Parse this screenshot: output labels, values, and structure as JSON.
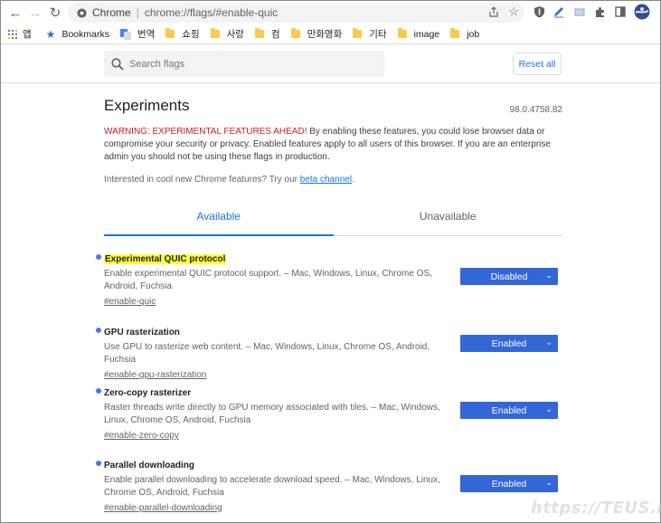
{
  "omnibox": {
    "site": "Chrome",
    "url": "chrome://flags/#enable-quic"
  },
  "bookmarks": [
    {
      "label": "앱",
      "icon": "apps-grid-icon"
    },
    {
      "label": "Bookmarks",
      "icon": "star-icon"
    },
    {
      "label": "번역",
      "icon": "translate-icon"
    },
    {
      "label": "쇼핑",
      "icon": "folder-icon"
    },
    {
      "label": "사랑",
      "icon": "folder-icon"
    },
    {
      "label": "컴",
      "icon": "folder-icon"
    },
    {
      "label": "만화영화",
      "icon": "folder-icon"
    },
    {
      "label": "기타",
      "icon": "folder-icon"
    },
    {
      "label": "image",
      "icon": "folder-icon"
    },
    {
      "label": "job",
      "icon": "folder-icon"
    }
  ],
  "search": {
    "placeholder": "Search flags"
  },
  "reset_label": "Reset all",
  "page": {
    "title": "Experiments",
    "version": "98.0.4758.82",
    "warning_red": "WARNING: EXPERIMENTAL FEATURES AHEAD!",
    "warning_text": " By enabling these features, you could lose browser data or compromise your security or privacy. Enabled features apply to all users of this browser. If you are an enterprise admin you should not be using these flags in production.",
    "interest_text": "Interested in cool new Chrome features? Try our ",
    "interest_link": "beta channel",
    "interest_end": "."
  },
  "tabs": [
    {
      "label": "Available",
      "active": true
    },
    {
      "label": "Unavailable",
      "active": false
    }
  ],
  "flags": [
    {
      "name": "Experimental QUIC protocol",
      "description": "Enable experimental QUIC protocol support. – Mac, Windows, Linux, Chrome OS, Android, Fuchsia",
      "id": "#enable-quic",
      "value": "Disabled",
      "highlighted": true
    },
    {
      "name": "GPU rasterization",
      "description": "Use GPU to rasterize web content. – Mac, Windows, Linux, Chrome OS, Android, Fuchsia",
      "id": "#enable-gpu-rasterization",
      "value": "Enabled",
      "highlighted": false
    },
    {
      "name": "Zero-copy rasterizer",
      "description": "Raster threads write directly to GPU memory associated with tiles. – Mac, Windows, Linux, Chrome OS, Android, Fuchsia",
      "id": "#enable-zero-copy",
      "value": "Enabled",
      "highlighted": false
    },
    {
      "name": "Parallel downloading",
      "description": "Enable parallel downloading to accelerate download speed. – Mac, Windows, Linux, Chrome OS, Android, Fuchsia",
      "id": "#enable-parallel-downloading",
      "value": "Enabled",
      "highlighted": false
    }
  ],
  "watermark": "https://TEUS.me",
  "colors": {
    "accent": "#1a73e8",
    "select_bg": "#3367d6",
    "warning": "#c5221f",
    "highlight": "#ffff3a"
  }
}
